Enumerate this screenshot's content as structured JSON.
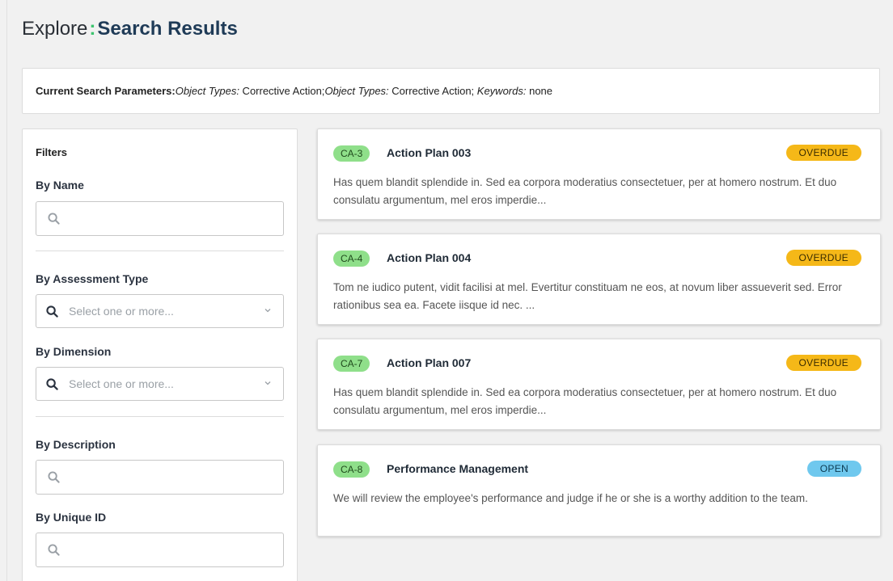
{
  "header": {
    "explore": "Explore",
    "separator": ":",
    "title": "Search Results"
  },
  "search_params": {
    "label": "Current Search Parameters:",
    "items": [
      {
        "key": "Object Types:",
        "value": " Corrective Action;"
      },
      {
        "key": "Object Types:",
        "value": " Corrective Action; "
      },
      {
        "key": "Keywords:",
        "value": " none"
      }
    ]
  },
  "filters": {
    "title": "Filters",
    "by_name": {
      "label": "By Name",
      "placeholder": ""
    },
    "by_assessment_type": {
      "label": "By Assessment Type",
      "placeholder": "Select one or more..."
    },
    "by_dimension": {
      "label": "By Dimension",
      "placeholder": "Select one or more..."
    },
    "by_description": {
      "label": "By Description",
      "placeholder": ""
    },
    "by_unique_id": {
      "label": "By Unique ID",
      "placeholder": ""
    }
  },
  "results": [
    {
      "id": "CA-3",
      "title": "Action Plan 003",
      "status": "OVERDUE",
      "description": "Has quem blandit splendide in. Sed ea corpora moderatius consectetuer, per at homero nostrum. Et duo consulatu argumentum, mel eros imperdie..."
    },
    {
      "id": "CA-4",
      "title": "Action Plan 004",
      "status": "OVERDUE",
      "description": "Tom ne iudico putent, vidit facilisi at mel. Evertitur constituam ne eos, at novum liber assueverit sed. Error rationibus sea ea. Facete iisque id nec. ..."
    },
    {
      "id": "CA-7",
      "title": "Action Plan 007",
      "status": "OVERDUE",
      "description": "Has quem blandit splendide in. Sed ea corpora moderatius consectetuer, per at homero nostrum. Et duo consulatu argumentum, mel eros imperdie..."
    },
    {
      "id": "CA-8",
      "title": "Performance Management",
      "status": "OPEN",
      "description": "We will review the employee's performance and judge if he or she is a worthy addition to the team."
    }
  ],
  "colors": {
    "accent": "#3cc46e",
    "overdue": "#f5b818",
    "open": "#6fc8ee",
    "tag": "#8fdf8a"
  },
  "icons": {
    "search": "search-icon",
    "chevron": "chevron-down-icon"
  }
}
